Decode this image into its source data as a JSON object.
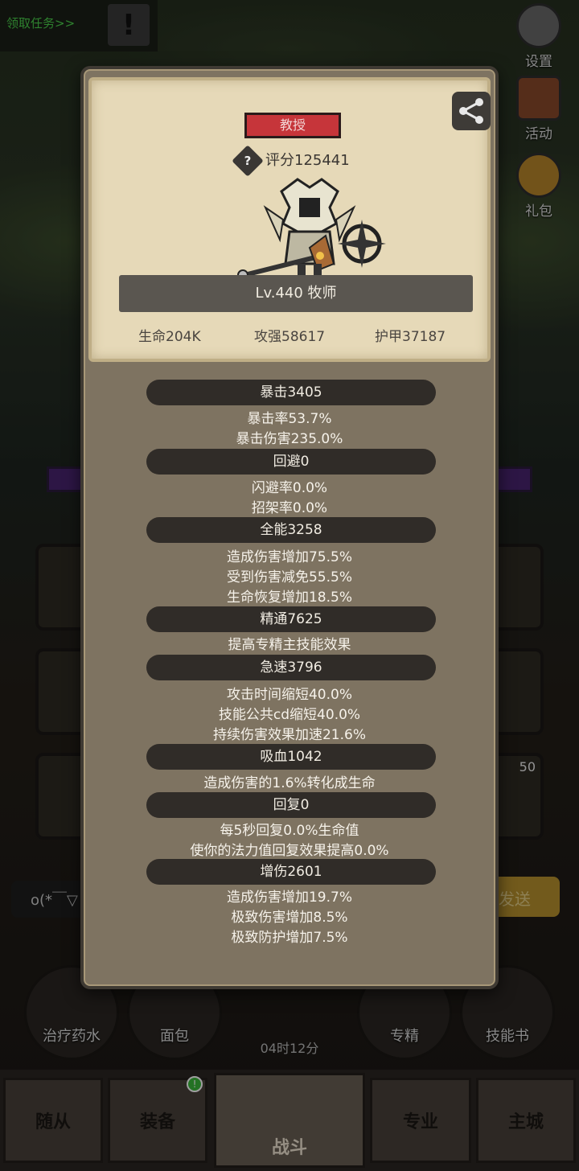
{
  "background": {
    "quest_link": "领取任务>>",
    "side_buttons": [
      {
        "label": "设置",
        "icon": "gear-icon"
      },
      {
        "label": "活动",
        "icon": "calendar-icon"
      },
      {
        "label": "礼包",
        "icon": "gift-icon"
      }
    ],
    "slot_level": "50",
    "chat_text": "o(*￣▽",
    "send_label": "发送",
    "items": [
      {
        "label": "治疗药水",
        "icon": "potion-icon"
      },
      {
        "label": "面包",
        "icon": "bread-icon"
      },
      {
        "label": "专精",
        "icon": "specialty-icon"
      },
      {
        "label": "技能书",
        "icon": "skill-book-icon"
      }
    ],
    "timer": "04时12分",
    "nav": {
      "followers": "随从",
      "equipment": "装备",
      "battle": "战斗",
      "profession": "专业",
      "main_city": "主城"
    }
  },
  "dialog": {
    "title_badge": "教授",
    "score": "评分125441",
    "name_level": "Lv.440 牧师",
    "main_stats": {
      "hp": "生命204K",
      "attack": "攻强58617",
      "armor": "护甲37187"
    },
    "sections": [
      {
        "header": "暴击3405",
        "lines": [
          "暴击率53.7%",
          "暴击伤害235.0%"
        ]
      },
      {
        "header": "回避0",
        "lines": [
          "闪避率0.0%",
          "招架率0.0%"
        ]
      },
      {
        "header": "全能3258",
        "lines": [
          "造成伤害增加75.5%",
          "受到伤害减免55.5%",
          "生命恢复增加18.5%"
        ]
      },
      {
        "header": "精通7625",
        "lines": [
          "提高专精主技能效果"
        ]
      },
      {
        "header": "急速3796",
        "lines": [
          "攻击时间缩短40.0%",
          "技能公共cd缩短40.0%",
          "持续伤害效果加速21.6%"
        ]
      },
      {
        "header": "吸血1042",
        "lines": [
          "造成伤害的1.6%转化成生命"
        ]
      },
      {
        "header": "回复0",
        "lines": [
          "每5秒回复0.0%生命值",
          "使你的法力值回复效果提高0.0%"
        ]
      },
      {
        "header": "增伤2601",
        "lines": [
          "造成伤害增加19.7%",
          "极致伤害增加8.5%",
          "极致防护增加7.5%"
        ]
      }
    ]
  }
}
